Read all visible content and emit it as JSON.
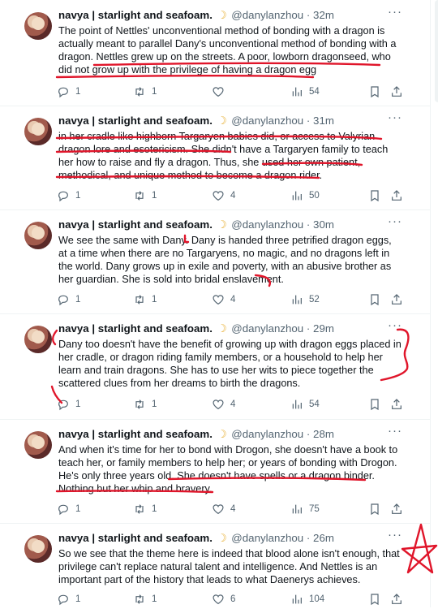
{
  "tweets": [
    {
      "name": "navya | starlight and seafoam.",
      "handle": "@danylanzhou",
      "time": "32m",
      "text": "The point of Nettles' unconventional method of bonding with a dragon is actually meant to parallel Dany's unconventional method of bonding with a dragon. Nettles grew up on the streets. A poor, lowborn dragonseed, who did not grow up with the privilege of having a dragon egg",
      "replies": "1",
      "retweets": "1",
      "likes": "",
      "views": "54"
    },
    {
      "name": "navya | starlight and seafoam.",
      "handle": "@danylanzhou",
      "time": "31m",
      "text": "in her cradle like highborn Targaryen babies did, or access to Valyrian dragon lore and esotericism. She didn't have a Targaryen family to teach her how to raise and fly a dragon. Thus, she used her own patient, methodical, and unique method to become a dragon rider.",
      "replies": "1",
      "retweets": "1",
      "likes": "4",
      "views": "50"
    },
    {
      "name": "navya | starlight and seafoam.",
      "handle": "@danylanzhou",
      "time": "30m",
      "text": "We see the same with Dany. Dany is handed three petrified dragon eggs, at a time when there are no Targaryens, no magic, and no dragons left in the world. Dany grows up in exile and poverty, with an abusive brother as her guardian. She is sold into bridal enslavement.",
      "replies": "1",
      "retweets": "1",
      "likes": "4",
      "views": "52"
    },
    {
      "name": "navya | starlight and seafoam.",
      "handle": "@danylanzhou",
      "time": "29m",
      "text": "Dany too doesn't have the benefit of growing up with dragon eggs placed in her cradle, or dragon riding family members, or a household to help her learn and train dragons. She has to use her wits to piece together the scattered clues from her dreams to birth the dragons.",
      "replies": "1",
      "retweets": "1",
      "likes": "4",
      "views": "54"
    },
    {
      "name": "navya | starlight and seafoam.",
      "handle": "@danylanzhou",
      "time": "28m",
      "text": "And when it's time for her to bond with Drogon, she doesn't have a book to teach her, or family members to help her; or years of bonding with Drogon. He's only three years old. She doesn't have spells or a dragon binder. Nothing but her whip and bravery.",
      "replies": "1",
      "retweets": "1",
      "likes": "4",
      "views": "75"
    },
    {
      "name": "navya | starlight and seafoam.",
      "handle": "@danylanzhou",
      "time": "26m",
      "text": "So we see that the theme here is indeed that blood alone isn't enough, that privilege can't replace natural talent and intelligence. And Nettles is an important part of the history that leads to what Daenerys achieves.",
      "replies": "1",
      "retweets": "1",
      "likes": "6",
      "views": "104"
    }
  ],
  "icons": {
    "moon": "crescent-moon-emoji",
    "more": "more-dots-icon",
    "reply": "reply-icon",
    "retweet": "retweet-icon",
    "like": "heart-icon",
    "views": "views-bar-chart-icon",
    "bookmark": "bookmark-icon",
    "share": "share-icon"
  },
  "colors": {
    "text": "#0f1419",
    "secondary": "#536471",
    "annotation": "#e0152a",
    "divider": "#eff3f4"
  }
}
